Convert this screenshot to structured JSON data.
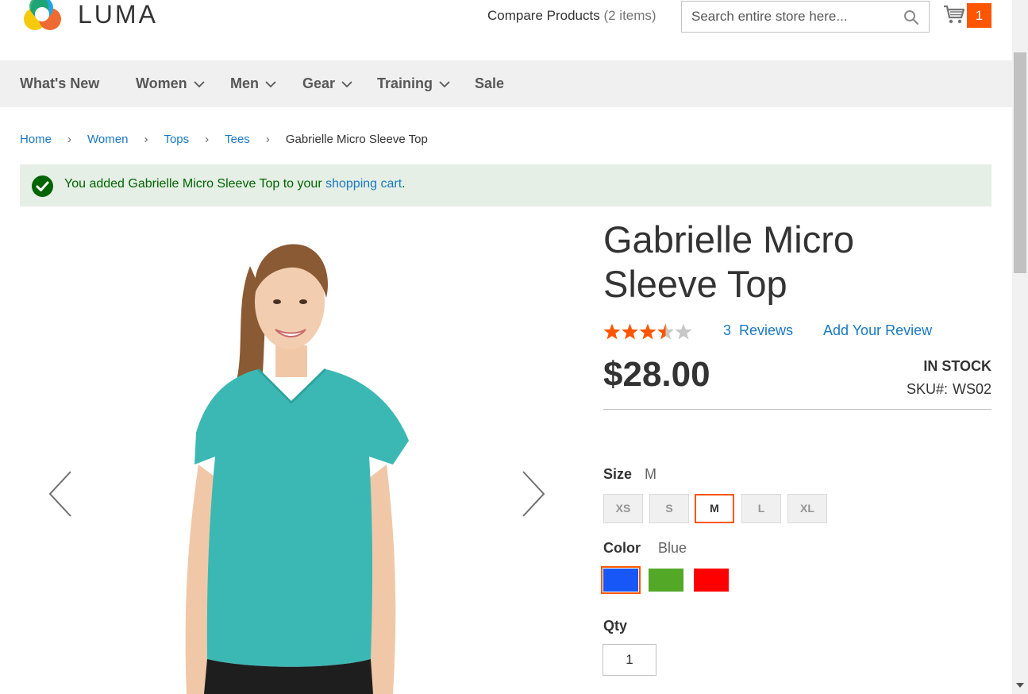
{
  "header": {
    "logo_text": "LUMA",
    "compare_label": "Compare Products",
    "compare_count": "(2 items)",
    "search_placeholder": "Search entire store here...",
    "cart_count": "1"
  },
  "nav": {
    "items": [
      {
        "label": "What's New",
        "dropdown": false
      },
      {
        "label": "Women",
        "dropdown": true
      },
      {
        "label": "Men",
        "dropdown": true
      },
      {
        "label": "Gear",
        "dropdown": true
      },
      {
        "label": "Training",
        "dropdown": true
      },
      {
        "label": "Sale",
        "dropdown": false
      }
    ]
  },
  "breadcrumb": {
    "items": [
      "Home",
      "Women",
      "Tops",
      "Tees"
    ],
    "current": "Gabrielle Micro Sleeve Top"
  },
  "message": {
    "prefix": "You added Gabrielle Micro Sleeve Top to your ",
    "link": "shopping cart",
    "suffix": "."
  },
  "product": {
    "title": "Gabrielle Micro Sleeve Top",
    "rating_stars": 3.5,
    "rating_max": 5,
    "reviews_count": "3",
    "reviews_label": "Reviews",
    "add_review_label": "Add Your Review",
    "price": "$28.00",
    "stock": "IN STOCK",
    "sku_label": "SKU#:",
    "sku": "WS02",
    "size_label": "Size",
    "size_selected": "M",
    "sizes": [
      "XS",
      "S",
      "M",
      "L",
      "XL"
    ],
    "color_label": "Color",
    "color_selected": "Blue",
    "colors": [
      {
        "name": "Blue",
        "hex": "#1857f7"
      },
      {
        "name": "Green",
        "hex": "#53a828"
      },
      {
        "name": "Red",
        "hex": "#ff0000"
      }
    ],
    "qty_label": "Qty",
    "qty_value": "1"
  },
  "colors": {
    "accent": "#ff5501",
    "link": "#1979c3",
    "star": "#ff5501",
    "message_bg": "#e5efe5",
    "message_text": "#006400",
    "shirt": "#3cb8b4"
  }
}
